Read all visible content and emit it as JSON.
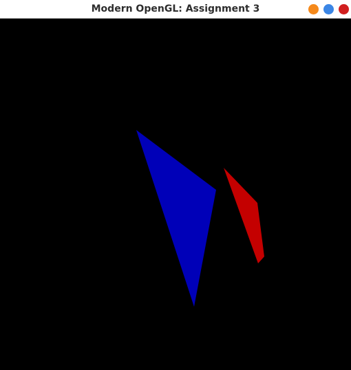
{
  "window": {
    "title": "Modern OpenGL: Assignment 3",
    "controls": [
      {
        "name": "minimize-button",
        "color": "#f5891b"
      },
      {
        "name": "maximize-button",
        "color": "#3b86e5"
      },
      {
        "name": "close-button",
        "color": "#d11f1f"
      }
    ]
  },
  "scene": {
    "background": "#000000",
    "shapes": [
      {
        "name": "blue-triangle",
        "color": "#0000b8"
      },
      {
        "name": "red-quad",
        "color": "#c40000"
      }
    ]
  }
}
